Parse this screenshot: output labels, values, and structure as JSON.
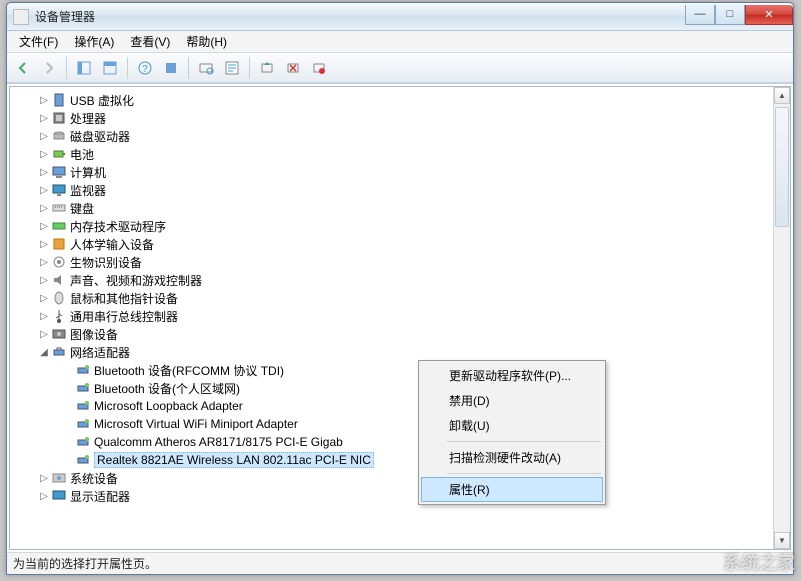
{
  "window": {
    "title": "设备管理器"
  },
  "menu": {
    "file": "文件(F)",
    "action": "操作(A)",
    "view": "查看(V)",
    "help": "帮助(H)"
  },
  "tree": {
    "categories": [
      {
        "label": "USB 虚拟化",
        "icon": "usb",
        "expanded": false
      },
      {
        "label": "处理器",
        "icon": "cpu",
        "expanded": false
      },
      {
        "label": "磁盘驱动器",
        "icon": "disk",
        "expanded": false
      },
      {
        "label": "电池",
        "icon": "battery",
        "expanded": false
      },
      {
        "label": "计算机",
        "icon": "computer",
        "expanded": false
      },
      {
        "label": "监视器",
        "icon": "monitor",
        "expanded": false
      },
      {
        "label": "键盘",
        "icon": "keyboard",
        "expanded": false
      },
      {
        "label": "内存技术驱动程序",
        "icon": "memory",
        "expanded": false
      },
      {
        "label": "人体学输入设备",
        "icon": "hid",
        "expanded": false
      },
      {
        "label": "生物识别设备",
        "icon": "biometric",
        "expanded": false
      },
      {
        "label": "声音、视频和游戏控制器",
        "icon": "sound",
        "expanded": false
      },
      {
        "label": "鼠标和其他指针设备",
        "icon": "mouse",
        "expanded": false
      },
      {
        "label": "通用串行总线控制器",
        "icon": "usbctl",
        "expanded": false
      },
      {
        "label": "图像设备",
        "icon": "imaging",
        "expanded": false
      },
      {
        "label": "网络适配器",
        "icon": "network",
        "expanded": true,
        "children": [
          {
            "label": "Bluetooth 设备(RFCOMM 协议 TDI)",
            "icon": "net"
          },
          {
            "label": "Bluetooth 设备(个人区域网)",
            "icon": "net"
          },
          {
            "label": "Microsoft Loopback Adapter",
            "icon": "net"
          },
          {
            "label": "Microsoft Virtual WiFi Miniport Adapter",
            "icon": "net"
          },
          {
            "label": "Qualcomm Atheros AR8171/8175 PCI-E Gigab",
            "icon": "net"
          },
          {
            "label": "Realtek 8821AE Wireless LAN 802.11ac PCI-E NIC",
            "icon": "net",
            "selected": true
          }
        ]
      },
      {
        "label": "系统设备",
        "icon": "system",
        "expanded": false
      },
      {
        "label": "显示适配器",
        "icon": "display",
        "expanded": false
      }
    ]
  },
  "context_menu": {
    "update_driver": "更新驱动程序软件(P)...",
    "disable": "禁用(D)",
    "uninstall": "卸载(U)",
    "scan_hw": "扫描检测硬件改动(A)",
    "properties": "属性(R)"
  },
  "statusbar": "为当前的选择打开属性页。",
  "watermark": "系统之家"
}
